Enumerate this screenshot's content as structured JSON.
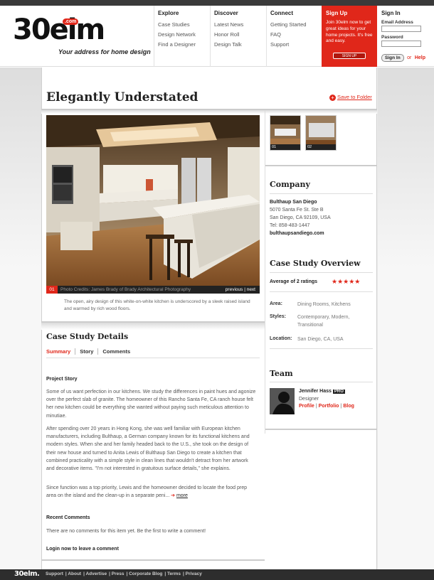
{
  "logo": {
    "text": "30elm",
    "com": ".com",
    "tagline": "Your address for home design"
  },
  "nav": [
    {
      "heading": "Explore",
      "links": [
        "Case Studies",
        "Design Network",
        "Find a Designer"
      ]
    },
    {
      "heading": "Discover",
      "links": [
        "Latest News",
        "Honor Roll",
        "Design Talk"
      ]
    },
    {
      "heading": "Connect",
      "links": [
        "Getting Started",
        "FAQ",
        "Support"
      ]
    }
  ],
  "signup": {
    "heading": "Sign Up",
    "text": "Join 30elm now to get great ideas for your home projects. It's free and easy.",
    "button": "SIGN UP"
  },
  "signin": {
    "heading": "Sign In",
    "email_label": "Email Address",
    "password_label": "Password",
    "button": "Sign In",
    "or": "or",
    "help": "Help"
  },
  "page": {
    "title": "Elegantly Understated",
    "save": "Save to Folder"
  },
  "photo": {
    "number": "01",
    "credits": "Photo Credits: James Brady of Brady Architectural Photography",
    "previous": "previous",
    "sep": "|",
    "next": "next",
    "caption": "The open, airy design of this white-on-white kitchen is underscored by a sleek raised island and warmed by rich wood floors."
  },
  "thumbs": [
    "01",
    "02"
  ],
  "company": {
    "heading": "Company",
    "name": "Bulthaup San Diego",
    "address1": "5070 Santa Fe St. Ste B",
    "address2": "San Diego, CA 92109, USA",
    "tel": "Tel: 858-483-1447",
    "web": "bulthaupsandiego.com"
  },
  "overview": {
    "heading": "Case Study Overview",
    "ratings": "Average of 2 ratings",
    "stars": "★★★★★",
    "rating_value": 5,
    "area_label": "Area:",
    "area": "Dining Rooms, Kitchens",
    "styles_label": "Styles:",
    "styles": "Contemporary, Modern, Transitional",
    "location_label": "Location:",
    "location": "San Diego, CA, USA"
  },
  "team": {
    "heading": "Team",
    "name": "Jennifer Hass",
    "badge": "PRO",
    "role": "Designer",
    "profile": "Profile",
    "portfolio": "Portfolio",
    "blog": "Blog",
    "sep": "|"
  },
  "details": {
    "heading": "Case Study Details",
    "tabs": [
      "Summary",
      "Story",
      "Comments"
    ]
  },
  "story": {
    "heading": "Project Story",
    "p1": "Some of us want perfection in our kitchens. We study the differences in paint hues and agonize over the perfect slab of granite. The homeowner of this Rancho Santa Fe, CA ranch house felt her new kitchen could be everything she wanted without paying such meticulous attention to minutiae.",
    "p2": "After spending over 20 years in Hong Kong, she was well familiar with European kitchen manufacturers, including Bulthaup, a German company known for its functional kitchens and modern styles. When she and her family headed back to the U.S., she took on the design of their new house and turned to Anita Lewis of Bulthaup San Diego to create a kitchen that combined practicality with a simple style in clean lines that wouldn't detract from her artwork and decorative items. \"I'm not interested in gratuitous surface details,\" she explains.",
    "p3": "Since function was a top priority, Lewis and the homeowner decided to locate the food prep area on the island and the clean-up in a separate peni...",
    "more": "more"
  },
  "comments": {
    "heading": "Recent Comments",
    "empty": "There are no comments for this item yet. Be the first to write a comment!",
    "login": "Login now to leave a comment"
  },
  "footer": {
    "logo": "30elm.",
    "links": [
      "Support",
      "About",
      "Advertise",
      "Press",
      "Corporate Blog",
      "Terms",
      "Privacy"
    ]
  },
  "colors": {
    "accent": "#e0271a",
    "dark": "#2d2d2d"
  }
}
